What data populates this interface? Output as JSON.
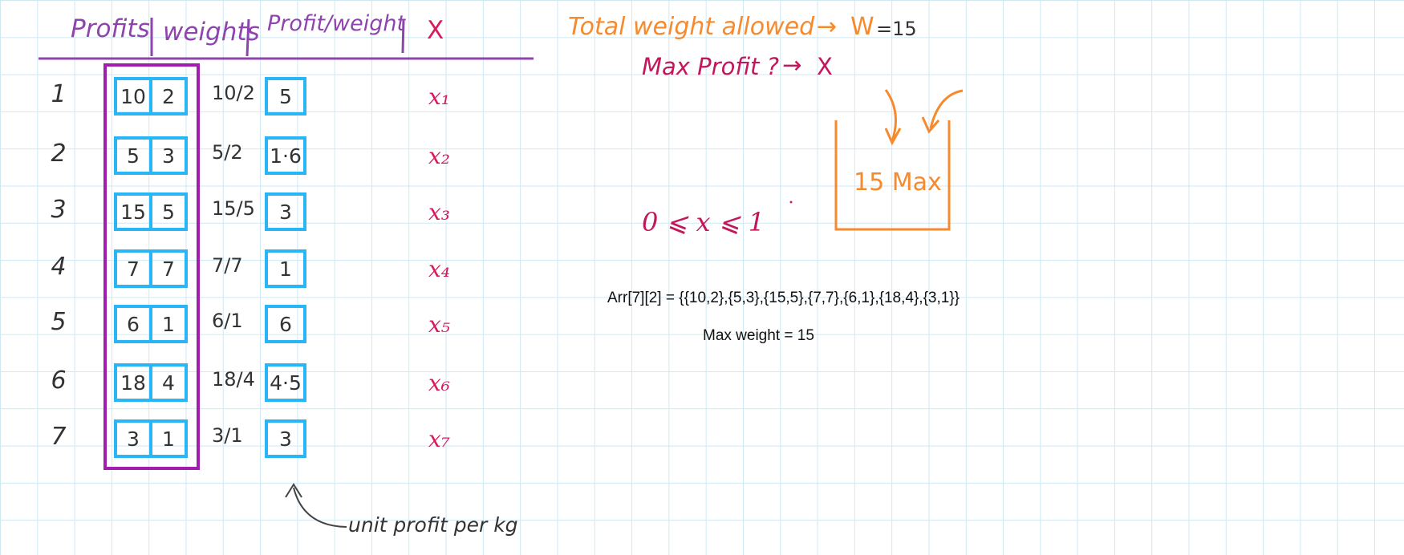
{
  "header": {
    "profits": "Profits",
    "weights": "weights",
    "profit_weight": "Profit/weight",
    "x": "X"
  },
  "rows": [
    {
      "index": "1",
      "profit": "10",
      "weight": "2",
      "fraction": "10/2",
      "ratio": "5",
      "x": "x₁"
    },
    {
      "index": "2",
      "profit": "5",
      "weight": "3",
      "fraction": "5/2",
      "ratio": "1·6",
      "x": "x₂"
    },
    {
      "index": "3",
      "profit": "15",
      "weight": "5",
      "fraction": "15/5",
      "ratio": "3",
      "x": "x₃"
    },
    {
      "index": "4",
      "profit": "7",
      "weight": "7",
      "fraction": "7/7",
      "ratio": "1",
      "x": "x₄"
    },
    {
      "index": "5",
      "profit": "6",
      "weight": "1",
      "fraction": "6/1",
      "ratio": "6",
      "x": "x₅"
    },
    {
      "index": "6",
      "profit": "18",
      "weight": "4",
      "fraction": "18/4",
      "ratio": "4·5",
      "x": "x₆"
    },
    {
      "index": "7",
      "profit": "3",
      "weight": "1",
      "fraction": "3/1",
      "ratio": "3",
      "x": "x₇"
    }
  ],
  "notes": {
    "total_weight": "Total weight allowed",
    "w_symbol": "W",
    "w_value": "=15",
    "max_profit": "Max Profit ?",
    "max_profit_x": "X",
    "bag_label": "15 Max",
    "constraint": "0 ⩽ x ⩽ 1",
    "unit_profit": "unit profit per kg",
    "arr": "Arr[7][2] = {{10,2},{5,3},{15,5},{7,7},{6,1},{18,4},{3,1}}",
    "max_weight": "Max weight = 15"
  },
  "colors": {
    "header": "#8e44ad",
    "cells": "#29b6f6",
    "highlight_box": "#a21caf",
    "x_vars": "#d81b60",
    "orange": "#f58a2e",
    "magenta": "#c2185b",
    "grid": "#cfe9f3"
  }
}
